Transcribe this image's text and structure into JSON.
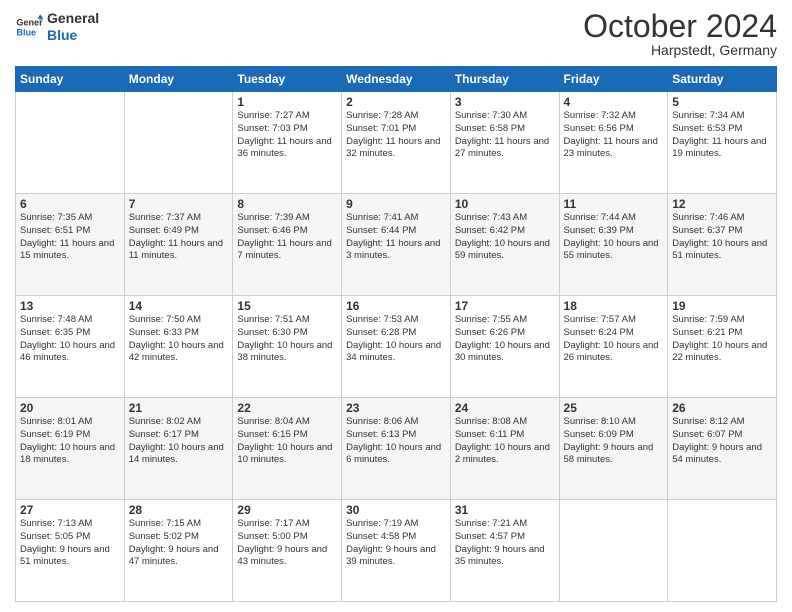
{
  "header": {
    "logo_line1": "General",
    "logo_line2": "Blue",
    "month": "October 2024",
    "location": "Harpstedt, Germany"
  },
  "weekdays": [
    "Sunday",
    "Monday",
    "Tuesday",
    "Wednesday",
    "Thursday",
    "Friday",
    "Saturday"
  ],
  "weeks": [
    [
      {
        "day": "",
        "info": ""
      },
      {
        "day": "",
        "info": ""
      },
      {
        "day": "1",
        "info": "Sunrise: 7:27 AM\nSunset: 7:03 PM\nDaylight: 11 hours and 36 minutes."
      },
      {
        "day": "2",
        "info": "Sunrise: 7:28 AM\nSunset: 7:01 PM\nDaylight: 11 hours and 32 minutes."
      },
      {
        "day": "3",
        "info": "Sunrise: 7:30 AM\nSunset: 6:58 PM\nDaylight: 11 hours and 27 minutes."
      },
      {
        "day": "4",
        "info": "Sunrise: 7:32 AM\nSunset: 6:56 PM\nDaylight: 11 hours and 23 minutes."
      },
      {
        "day": "5",
        "info": "Sunrise: 7:34 AM\nSunset: 6:53 PM\nDaylight: 11 hours and 19 minutes."
      }
    ],
    [
      {
        "day": "6",
        "info": "Sunrise: 7:35 AM\nSunset: 6:51 PM\nDaylight: 11 hours and 15 minutes."
      },
      {
        "day": "7",
        "info": "Sunrise: 7:37 AM\nSunset: 6:49 PM\nDaylight: 11 hours and 11 minutes."
      },
      {
        "day": "8",
        "info": "Sunrise: 7:39 AM\nSunset: 6:46 PM\nDaylight: 11 hours and 7 minutes."
      },
      {
        "day": "9",
        "info": "Sunrise: 7:41 AM\nSunset: 6:44 PM\nDaylight: 11 hours and 3 minutes."
      },
      {
        "day": "10",
        "info": "Sunrise: 7:43 AM\nSunset: 6:42 PM\nDaylight: 10 hours and 59 minutes."
      },
      {
        "day": "11",
        "info": "Sunrise: 7:44 AM\nSunset: 6:39 PM\nDaylight: 10 hours and 55 minutes."
      },
      {
        "day": "12",
        "info": "Sunrise: 7:46 AM\nSunset: 6:37 PM\nDaylight: 10 hours and 51 minutes."
      }
    ],
    [
      {
        "day": "13",
        "info": "Sunrise: 7:48 AM\nSunset: 6:35 PM\nDaylight: 10 hours and 46 minutes."
      },
      {
        "day": "14",
        "info": "Sunrise: 7:50 AM\nSunset: 6:33 PM\nDaylight: 10 hours and 42 minutes."
      },
      {
        "day": "15",
        "info": "Sunrise: 7:51 AM\nSunset: 6:30 PM\nDaylight: 10 hours and 38 minutes."
      },
      {
        "day": "16",
        "info": "Sunrise: 7:53 AM\nSunset: 6:28 PM\nDaylight: 10 hours and 34 minutes."
      },
      {
        "day": "17",
        "info": "Sunrise: 7:55 AM\nSunset: 6:26 PM\nDaylight: 10 hours and 30 minutes."
      },
      {
        "day": "18",
        "info": "Sunrise: 7:57 AM\nSunset: 6:24 PM\nDaylight: 10 hours and 26 minutes."
      },
      {
        "day": "19",
        "info": "Sunrise: 7:59 AM\nSunset: 6:21 PM\nDaylight: 10 hours and 22 minutes."
      }
    ],
    [
      {
        "day": "20",
        "info": "Sunrise: 8:01 AM\nSunset: 6:19 PM\nDaylight: 10 hours and 18 minutes."
      },
      {
        "day": "21",
        "info": "Sunrise: 8:02 AM\nSunset: 6:17 PM\nDaylight: 10 hours and 14 minutes."
      },
      {
        "day": "22",
        "info": "Sunrise: 8:04 AM\nSunset: 6:15 PM\nDaylight: 10 hours and 10 minutes."
      },
      {
        "day": "23",
        "info": "Sunrise: 8:06 AM\nSunset: 6:13 PM\nDaylight: 10 hours and 6 minutes."
      },
      {
        "day": "24",
        "info": "Sunrise: 8:08 AM\nSunset: 6:11 PM\nDaylight: 10 hours and 2 minutes."
      },
      {
        "day": "25",
        "info": "Sunrise: 8:10 AM\nSunset: 6:09 PM\nDaylight: 9 hours and 58 minutes."
      },
      {
        "day": "26",
        "info": "Sunrise: 8:12 AM\nSunset: 6:07 PM\nDaylight: 9 hours and 54 minutes."
      }
    ],
    [
      {
        "day": "27",
        "info": "Sunrise: 7:13 AM\nSunset: 5:05 PM\nDaylight: 9 hours and 51 minutes."
      },
      {
        "day": "28",
        "info": "Sunrise: 7:15 AM\nSunset: 5:02 PM\nDaylight: 9 hours and 47 minutes."
      },
      {
        "day": "29",
        "info": "Sunrise: 7:17 AM\nSunset: 5:00 PM\nDaylight: 9 hours and 43 minutes."
      },
      {
        "day": "30",
        "info": "Sunrise: 7:19 AM\nSunset: 4:58 PM\nDaylight: 9 hours and 39 minutes."
      },
      {
        "day": "31",
        "info": "Sunrise: 7:21 AM\nSunset: 4:57 PM\nDaylight: 9 hours and 35 minutes."
      },
      {
        "day": "",
        "info": ""
      },
      {
        "day": "",
        "info": ""
      }
    ]
  ]
}
